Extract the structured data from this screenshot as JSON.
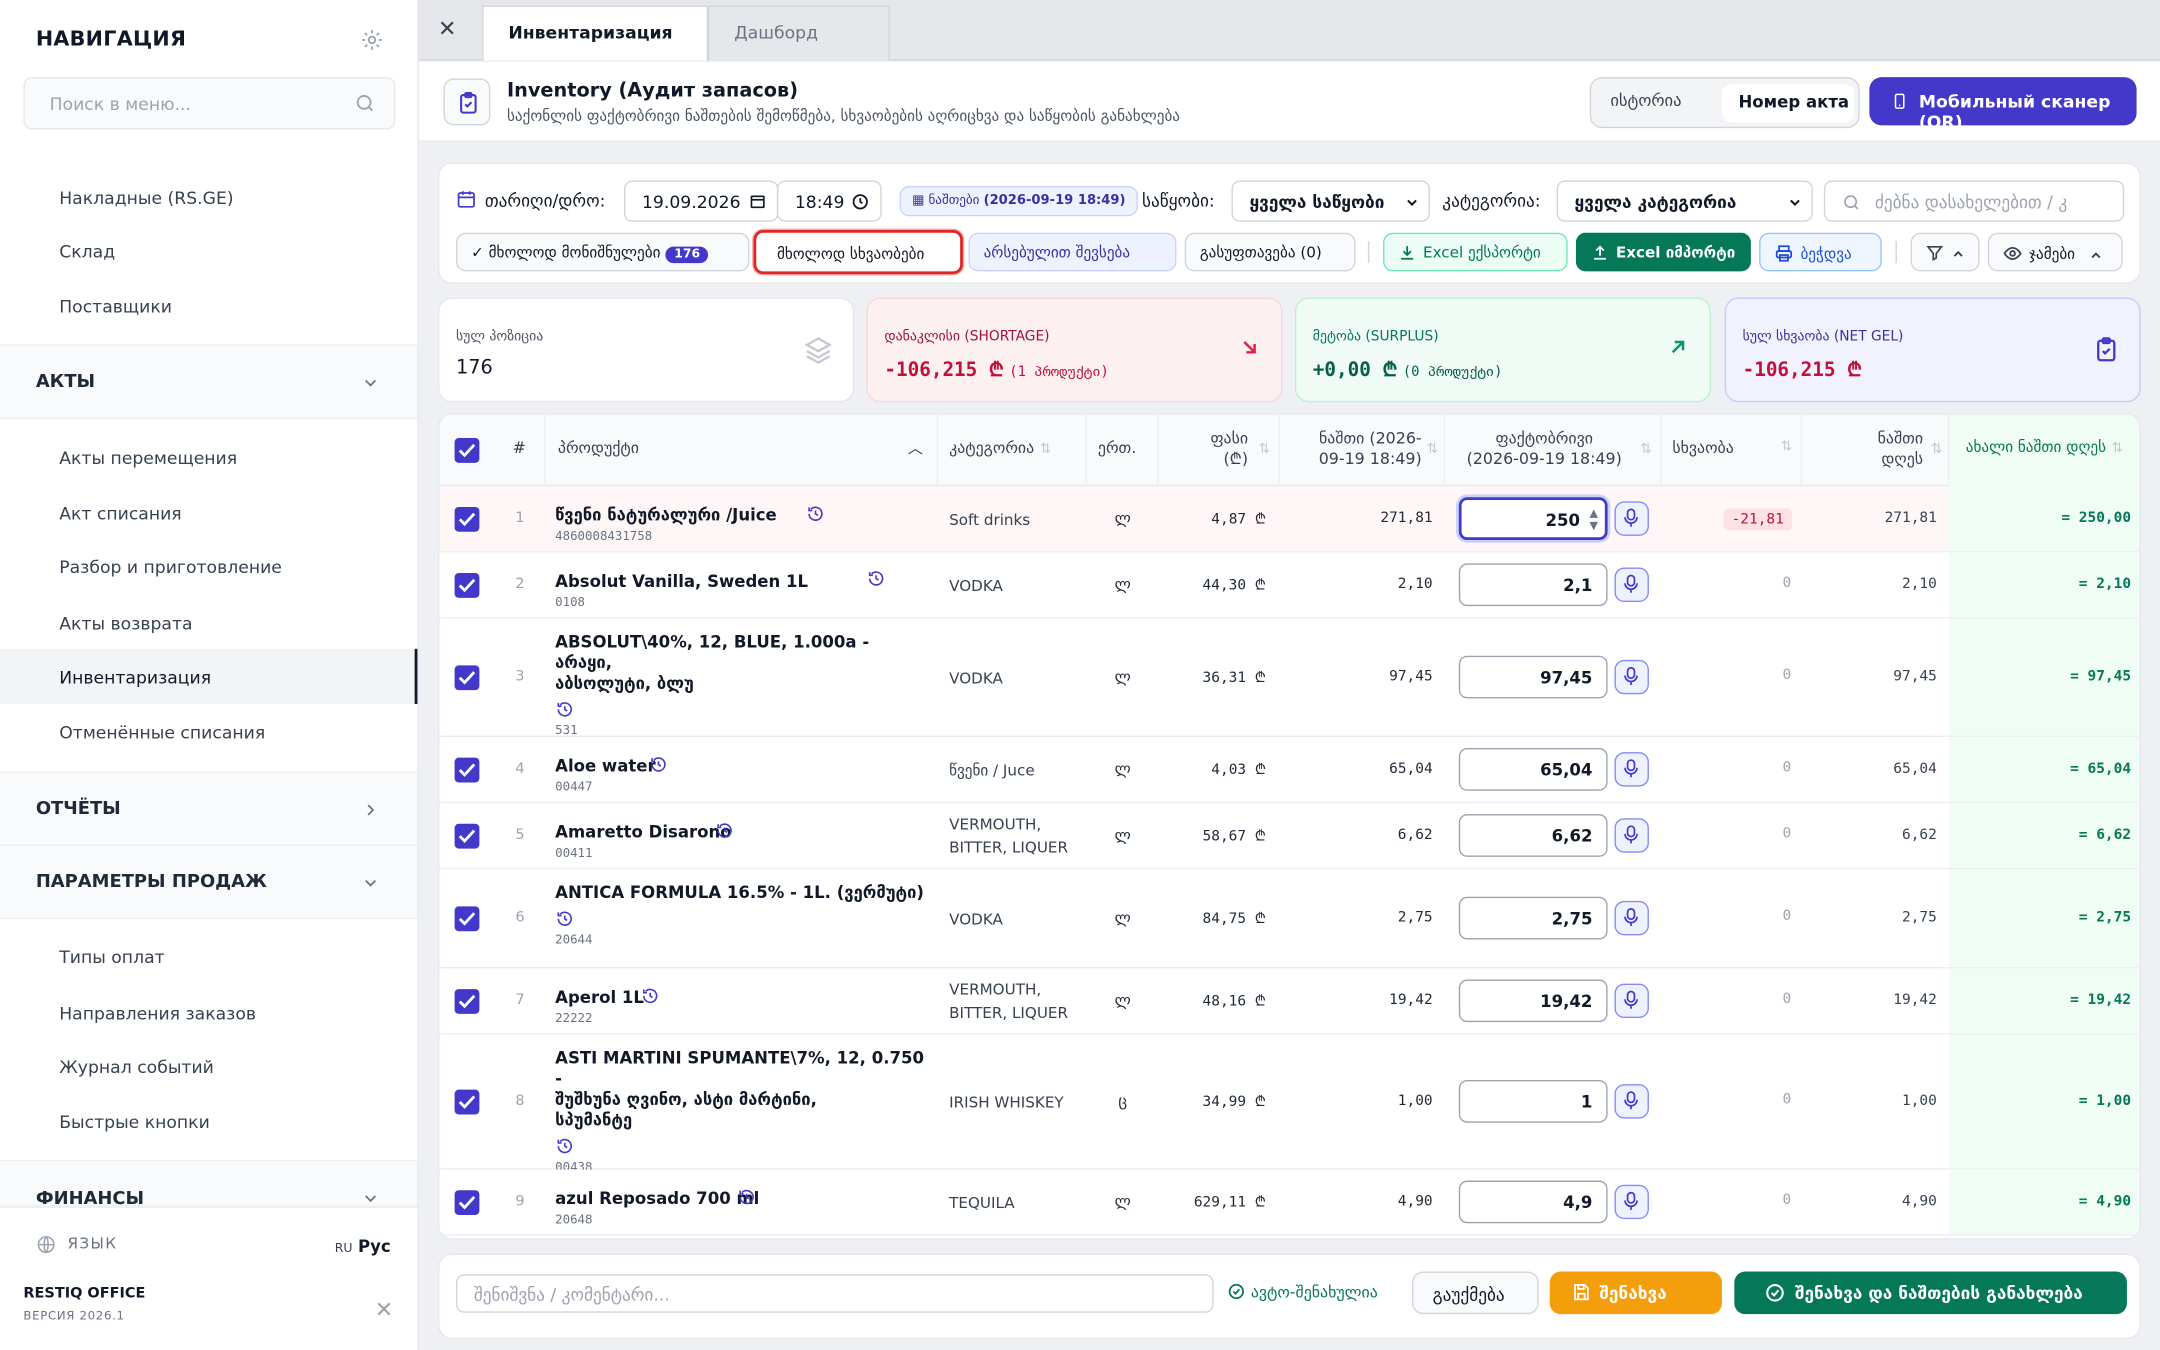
{
  "sidebar": {
    "title": "НАВИГАЦИЯ",
    "search_placeholder": "Поиск в меню...",
    "items_top": [
      "Накладные (RS.GE)",
      "Склад",
      "Поставщики"
    ],
    "section_acts": "АКТЫ",
    "acts_items": [
      "Акты перемещения",
      "Акт списания",
      "Разбор и приготовление",
      "Акты возврата",
      "Инвентаризация",
      "Отменённые списания"
    ],
    "section_reports": "ОТЧЁТЫ",
    "section_sales": "ПАРАМЕТРЫ ПРОДАЖ",
    "sales_items": [
      "Типы оплат",
      "Направления заказов",
      "Журнал событий",
      "Быстрые кнопки"
    ],
    "section_finance": "ФИНАНСЫ",
    "lang_label": "ЯЗЫК",
    "lang_code": "RU",
    "lang_value": "Рус",
    "brand": "RESTIQ OFFICE",
    "version": "ВЕРСИЯ 2026.1"
  },
  "tabs": {
    "active": "Инвентаризация",
    "inactive": "Дашборд"
  },
  "header": {
    "title": "Inventory (Аудит запасов)",
    "subtitle": "საქონლის ფაქტობრივი ნაშთების შემოწმება, სხვაობების აღრიცხვა და საწყობის განახლება",
    "seg_history": "ისტორია",
    "seg_act": "Номер акта",
    "scan_button": "Мобильный сканер (QR)"
  },
  "filters": {
    "date_label": "თარიღი/დრო:",
    "date_value": "19.09.2026",
    "time_value": "18:49",
    "snapshot_label": "ნაშთები",
    "snapshot_value": "(2026-09-19 18:49)",
    "warehouse_label": "საწყობი:",
    "warehouse_value": "ყველა საწყობი",
    "category_label": "კატეგორია:",
    "category_value": "ყველა კატეგორია",
    "search_placeholder": "ძებნა დასახელებით / კ",
    "chip_selected": "✓ მხოლოდ მონიშნულები",
    "chip_selected_count": "176",
    "chip_diff": "მხოლოდ სხვაობები",
    "chip_zero": "არსებულით შევსება",
    "chip_clear": "გასუფთავება (0)",
    "btn_export": "Excel ექსპორტი",
    "btn_import": "Excel იმპორტი",
    "btn_print": "ბეჭდვა",
    "btn_columns": "ჯამები"
  },
  "kpis": {
    "total_label": "სულ პოზიცია",
    "total_value": "176",
    "shortage_label": "დანაკლისი (SHORTAGE)",
    "shortage_value": "-106,215 ₾",
    "shortage_note": "(1 პროდუქტი)",
    "surplus_label": "მეტობა (SURPLUS)",
    "surplus_value": "+0,00 ₾",
    "surplus_note": "(0 პროდუქტი)",
    "net_label": "სულ სხვაობა (NET GEL)",
    "net_value": "-106,215 ₾"
  },
  "table": {
    "headers": {
      "num": "#",
      "product": "პროდუქტი",
      "category": "კატეგორია",
      "unit": "ერთ.",
      "price_1": "ფასი",
      "price_2": "(₾)",
      "stock_1": "ნაშთი (2026-",
      "stock_2": "09-19 18:49)",
      "fact_1": "ფაქტობრივი",
      "fact_2": "(2026-09-19 18:49)",
      "diff": "სხვაობა",
      "day_1": "ნაშთი",
      "day_2": "დღეს",
      "new": "ახალი ნაშთი დღეს"
    },
    "rows": [
      {
        "n": "1",
        "name_lines": [
          "წვენი ნატურალური /Juice"
        ],
        "code": "4860008431758",
        "cat_lines": [
          "Soft drinks"
        ],
        "unit": "ლ",
        "price": "4,87 ₾",
        "stock": "271,81",
        "fact": "250",
        "diff": "-21,81",
        "today": "271,81",
        "new": "= 250,00"
      },
      {
        "n": "2",
        "name_lines": [
          "Absolut Vanilla, Sweden 1L"
        ],
        "code": "0108",
        "cat_lines": [
          "VODKA"
        ],
        "unit": "ლ",
        "price": "44,30 ₾",
        "stock": "2,10",
        "fact": "2,1",
        "diff": "0",
        "today": "2,10",
        "new": "= 2,10"
      },
      {
        "n": "3",
        "name_lines": [
          "ABSOLUT\\40%, 12, BLUE, 1.000a - არაყი,",
          "აბსოლუტი, ბლუ"
        ],
        "code": "531",
        "cat_lines": [
          "VODKA"
        ],
        "unit": "ლ",
        "price": "36,31 ₾",
        "stock": "97,45",
        "fact": "97,45",
        "diff": "0",
        "today": "97,45",
        "new": "= 97,45"
      },
      {
        "n": "4",
        "name_lines": [
          "Aloe water"
        ],
        "code": "00447",
        "cat_lines": [
          "წვენი / Juce"
        ],
        "unit": "ლ",
        "price": "4,03 ₾",
        "stock": "65,04",
        "fact": "65,04",
        "diff": "0",
        "today": "65,04",
        "new": "= 65,04"
      },
      {
        "n": "5",
        "name_lines": [
          "Amaretto Disarono"
        ],
        "code": "00411",
        "cat_lines": [
          "VERMOUTH,",
          "BITTER, LIQUER"
        ],
        "unit": "ლ",
        "price": "58,67 ₾",
        "stock": "6,62",
        "fact": "6,62",
        "diff": "0",
        "today": "6,62",
        "new": "= 6,62"
      },
      {
        "n": "6",
        "name_lines": [
          "ANTICA FORMULA 16.5% - 1L. (ვერმუტი)"
        ],
        "code": "20644",
        "cat_lines": [
          "VODKA"
        ],
        "unit": "ლ",
        "price": "84,75 ₾",
        "stock": "2,75",
        "fact": "2,75",
        "diff": "0",
        "today": "2,75",
        "new": "= 2,75"
      },
      {
        "n": "7",
        "name_lines": [
          "Aperol 1L"
        ],
        "code": "22222",
        "cat_lines": [
          "VERMOUTH,",
          "BITTER, LIQUER"
        ],
        "unit": "ლ",
        "price": "48,16 ₾",
        "stock": "19,42",
        "fact": "19,42",
        "diff": "0",
        "today": "19,42",
        "new": "= 19,42"
      },
      {
        "n": "8",
        "name_lines": [
          "ASTI MARTINI SPUMANTE\\7%, 12, 0.750 -",
          "შუშხუნა ღვინო, ასტი მარტინი,",
          "სპუმანტე"
        ],
        "code": "00438",
        "cat_lines": [
          "IRISH WHISKEY"
        ],
        "unit": "ც",
        "price": "34,99 ₾",
        "stock": "1,00",
        "fact": "1",
        "diff": "0",
        "today": "1,00",
        "new": "= 1,00"
      },
      {
        "n": "9",
        "name_lines": [
          "azul Reposado 700 ml"
        ],
        "code": "20648",
        "cat_lines": [
          "TEQUILA"
        ],
        "unit": "ლ",
        "price": "629,11 ₾",
        "stock": "4,90",
        "fact": "4,9",
        "diff": "0",
        "today": "4,90",
        "new": "= 4,90"
      }
    ]
  },
  "footer": {
    "comment_placeholder": "შენიშვნა / კომენტარი...",
    "autosave": "ავტო-შენახულია",
    "cancel": "გაუქმება",
    "save": "შენახვა",
    "save_apply": "შენახვა და ნაშთების განახლება"
  },
  "colors": {
    "accent": "#4338ca",
    "danger": "#dc2626",
    "success": "#047857",
    "warning": "#f59e0b"
  }
}
